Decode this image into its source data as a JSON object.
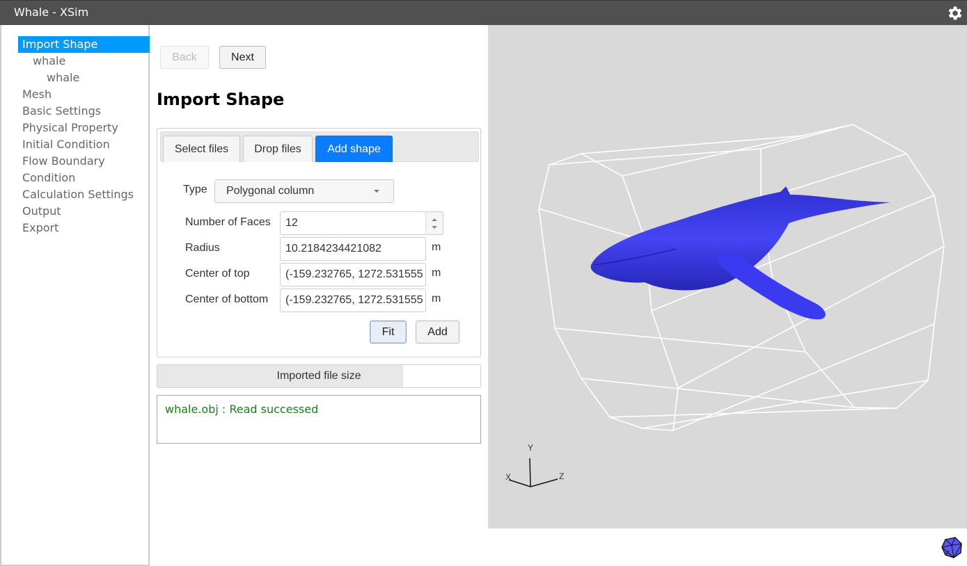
{
  "window": {
    "title": "Whale - XSim",
    "settings_icon": "gear-icon"
  },
  "sidebar": {
    "items": [
      {
        "label": "Import Shape",
        "level": 0,
        "active": true
      },
      {
        "label": "whale",
        "level": 1,
        "active": false
      },
      {
        "label": "whale",
        "level": 2,
        "active": false
      },
      {
        "label": "Mesh",
        "level": 0,
        "active": false
      },
      {
        "label": "Basic Settings",
        "level": 0,
        "active": false
      },
      {
        "label": "Physical Property",
        "level": 0,
        "active": false
      },
      {
        "label": "Initial Condition",
        "level": 0,
        "active": false
      },
      {
        "label": "Flow Boundary",
        "level": 0,
        "active": false
      },
      {
        "label": "Condition",
        "level": 0,
        "active": false
      },
      {
        "label": "Calculation Settings",
        "level": 0,
        "active": false
      },
      {
        "label": "Output",
        "level": 0,
        "active": false
      },
      {
        "label": "Export",
        "level": 0,
        "active": false
      }
    ]
  },
  "nav": {
    "back_label": "Back",
    "back_enabled": false,
    "next_label": "Next"
  },
  "main": {
    "title": "Import Shape",
    "tabs": [
      {
        "label": "Select files",
        "active": false
      },
      {
        "label": "Drop files",
        "active": false
      },
      {
        "label": "Add shape",
        "active": true
      }
    ],
    "form": {
      "type_label": "Type",
      "type_value": "Polygonal column",
      "faces_label": "Number of Faces",
      "faces_value": "12",
      "radius_label": "Radius",
      "radius_value": "10.2184234421082",
      "radius_unit": "m",
      "top_label": "Center of top",
      "top_value": "(-159.232765, 1272.531555",
      "top_unit": "m",
      "bottom_label": "Center of bottom",
      "bottom_value": "(-159.232765, 1272.531555",
      "bottom_unit": "m",
      "fit_label": "Fit",
      "add_label": "Add"
    },
    "file_size": {
      "label": "Imported file size",
      "progress_fraction": 0.76
    },
    "log": {
      "message": "whale.obj : Read successed",
      "color": "#1a7f1a"
    }
  },
  "viewport": {
    "background": "#d9d9d9",
    "model_color": "#3a3af0",
    "wireframe_color": "#ffffff",
    "axes": {
      "x": "X",
      "y": "Y",
      "z": "Z"
    },
    "view_cube_icon": "icosahedron-icon"
  }
}
